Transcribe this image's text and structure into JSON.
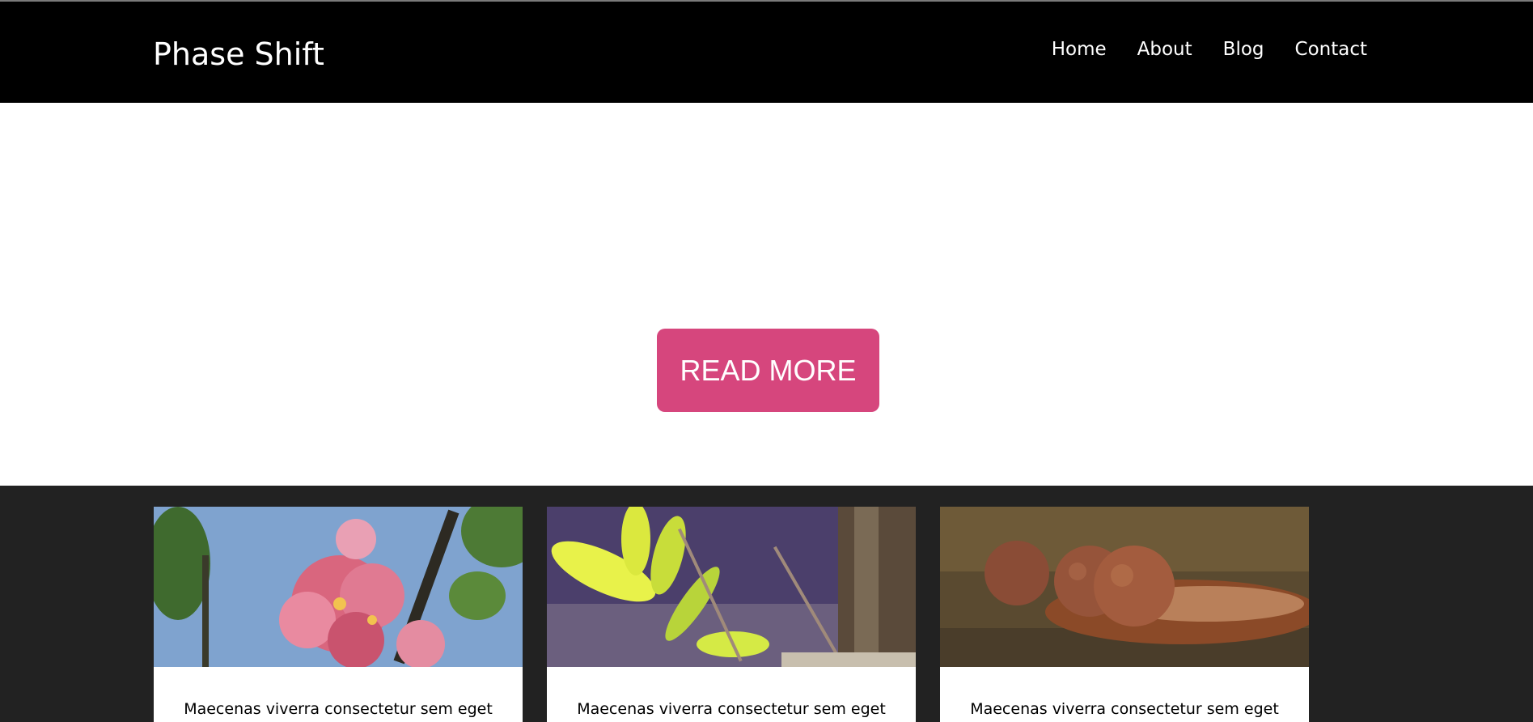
{
  "site": {
    "title": "Phase Shift"
  },
  "nav": {
    "items": [
      {
        "label": "Home"
      },
      {
        "label": "About"
      },
      {
        "label": "Blog"
      },
      {
        "label": "Contact"
      }
    ]
  },
  "hero": {
    "button_label": "READ MORE"
  },
  "posts": [
    {
      "image": "pink-flowers-photo",
      "excerpt": "Maecenas viverra consectetur sem eget"
    },
    {
      "image": "green-leaves-photo",
      "excerpt": "Maecenas viverra consectetur sem eget"
    },
    {
      "image": "brown-seeds-on-leaf-photo",
      "excerpt": "Maecenas viverra consectetur sem eget"
    }
  ],
  "colors": {
    "header_bg": "#000000",
    "button_bg": "#d6467d",
    "posts_bg": "#222222"
  }
}
